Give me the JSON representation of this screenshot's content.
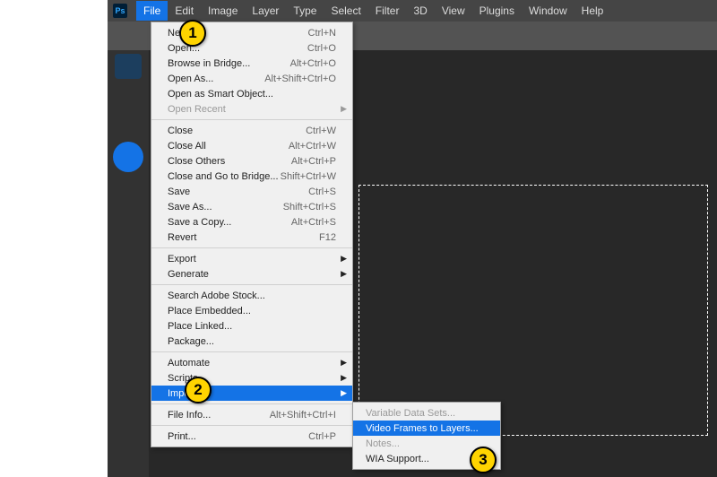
{
  "menubar": {
    "items": [
      "File",
      "Edit",
      "Image",
      "Layer",
      "Type",
      "Select",
      "Filter",
      "3D",
      "View",
      "Plugins",
      "Window",
      "Help"
    ],
    "active_index": 0,
    "logo_text": "Ps"
  },
  "file_menu": {
    "groups": [
      [
        {
          "label": "New...",
          "shortcut": "Ctrl+N"
        },
        {
          "label": "Open...",
          "shortcut": "Ctrl+O"
        },
        {
          "label": "Browse in Bridge...",
          "shortcut": "Alt+Ctrl+O"
        },
        {
          "label": "Open As...",
          "shortcut": "Alt+Shift+Ctrl+O"
        },
        {
          "label": "Open as Smart Object...",
          "shortcut": ""
        },
        {
          "label": "Open Recent",
          "shortcut": "",
          "submenu": true,
          "disabled": true
        }
      ],
      [
        {
          "label": "Close",
          "shortcut": "Ctrl+W"
        },
        {
          "label": "Close All",
          "shortcut": "Alt+Ctrl+W"
        },
        {
          "label": "Close Others",
          "shortcut": "Alt+Ctrl+P"
        },
        {
          "label": "Close and Go to Bridge...",
          "shortcut": "Shift+Ctrl+W"
        },
        {
          "label": "Save",
          "shortcut": "Ctrl+S"
        },
        {
          "label": "Save As...",
          "shortcut": "Shift+Ctrl+S"
        },
        {
          "label": "Save a Copy...",
          "shortcut": "Alt+Ctrl+S"
        },
        {
          "label": "Revert",
          "shortcut": "F12"
        }
      ],
      [
        {
          "label": "Export",
          "shortcut": "",
          "submenu": true
        },
        {
          "label": "Generate",
          "shortcut": "",
          "submenu": true
        }
      ],
      [
        {
          "label": "Search Adobe Stock...",
          "shortcut": ""
        },
        {
          "label": "Place Embedded...",
          "shortcut": ""
        },
        {
          "label": "Place Linked...",
          "shortcut": ""
        },
        {
          "label": "Package...",
          "shortcut": ""
        }
      ],
      [
        {
          "label": "Automate",
          "shortcut": "",
          "submenu": true
        },
        {
          "label": "Scripts",
          "shortcut": "",
          "submenu": true
        },
        {
          "label": "Import",
          "shortcut": "",
          "submenu": true,
          "highlight": true
        }
      ],
      [
        {
          "label": "File Info...",
          "shortcut": "Alt+Shift+Ctrl+I"
        }
      ],
      [
        {
          "label": "Print...",
          "shortcut": "Ctrl+P"
        }
      ]
    ]
  },
  "import_submenu": {
    "items": [
      {
        "label": "Variable Data Sets...",
        "disabled": true
      },
      {
        "label": "Video Frames to Layers...",
        "highlight": true
      },
      {
        "label": "Notes...",
        "disabled": true
      },
      {
        "label": "WIA Support..."
      }
    ]
  },
  "callouts": {
    "one": "1",
    "two": "2",
    "three": "3"
  }
}
